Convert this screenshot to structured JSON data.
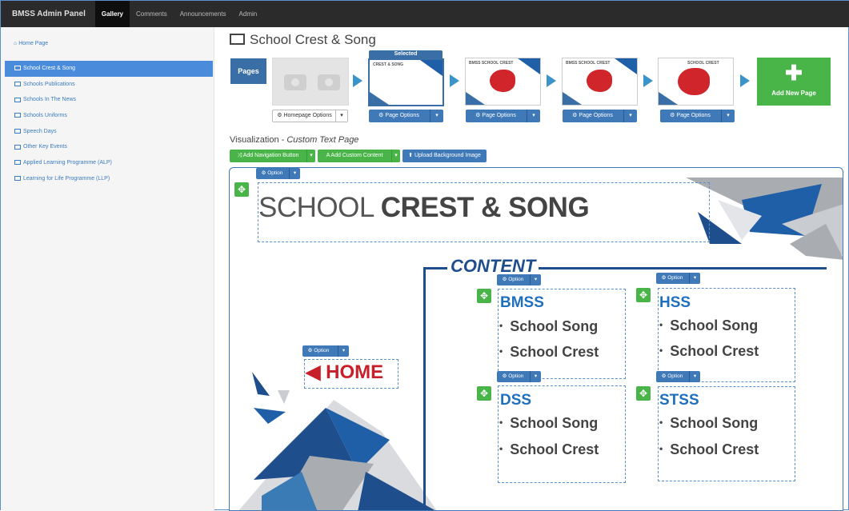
{
  "topbar": {
    "brand": "BMSS Admin Panel",
    "nav": [
      "Gallery",
      "Comments",
      "Announcements",
      "Admin"
    ]
  },
  "sidebar": {
    "home": "Home Page",
    "items": [
      {
        "label": "School Crest & Song",
        "active": true
      },
      {
        "label": "Schools Publications"
      },
      {
        "label": "Schools In The News"
      },
      {
        "label": "Schools Uniforms"
      },
      {
        "label": "Speech Days"
      },
      {
        "label": "Other Key Events"
      },
      {
        "label": "Applied Learning Programme (ALP)"
      },
      {
        "label": "Learning for Life Programme (LLP)"
      }
    ]
  },
  "main": {
    "title": "School Crest & Song",
    "pages_label": "Pages",
    "selected_label": "Selected",
    "homepage_options": "Homepage Options",
    "page_options": "Page Options",
    "add_new_page": "Add New Page",
    "thumb_titles": [
      "CREST & SONG",
      "BMSS SCHOOL CREST",
      "BMSS SCHOOL CREST",
      "SCHOOL CREST"
    ]
  },
  "visualization": {
    "label": "Visualization - ",
    "mode": "Custom Text Page",
    "add_nav_button": "Add Navigation Button",
    "add_custom_content": "Add Custom Content",
    "upload_bg": "Upload Background Image"
  },
  "canvas": {
    "option_label": "Option",
    "title_light": "SCHOOL ",
    "title_bold": "CREST & SONG",
    "home_label": "◀ HOME",
    "content_label": "CONTENT",
    "schools": [
      {
        "name": "BMSS",
        "items": [
          "School Song",
          "School Crest"
        ]
      },
      {
        "name": "HSS",
        "items": [
          "School Song",
          "School Crest"
        ]
      },
      {
        "name": "DSS",
        "items": [
          "School Song",
          "School Crest"
        ]
      },
      {
        "name": "STSS",
        "items": [
          "School Song",
          "School Crest"
        ]
      }
    ]
  },
  "colors": {
    "accent_blue": "#3f79b8",
    "green": "#49b549",
    "red": "#c8202a",
    "navy": "#1f4e8c"
  }
}
